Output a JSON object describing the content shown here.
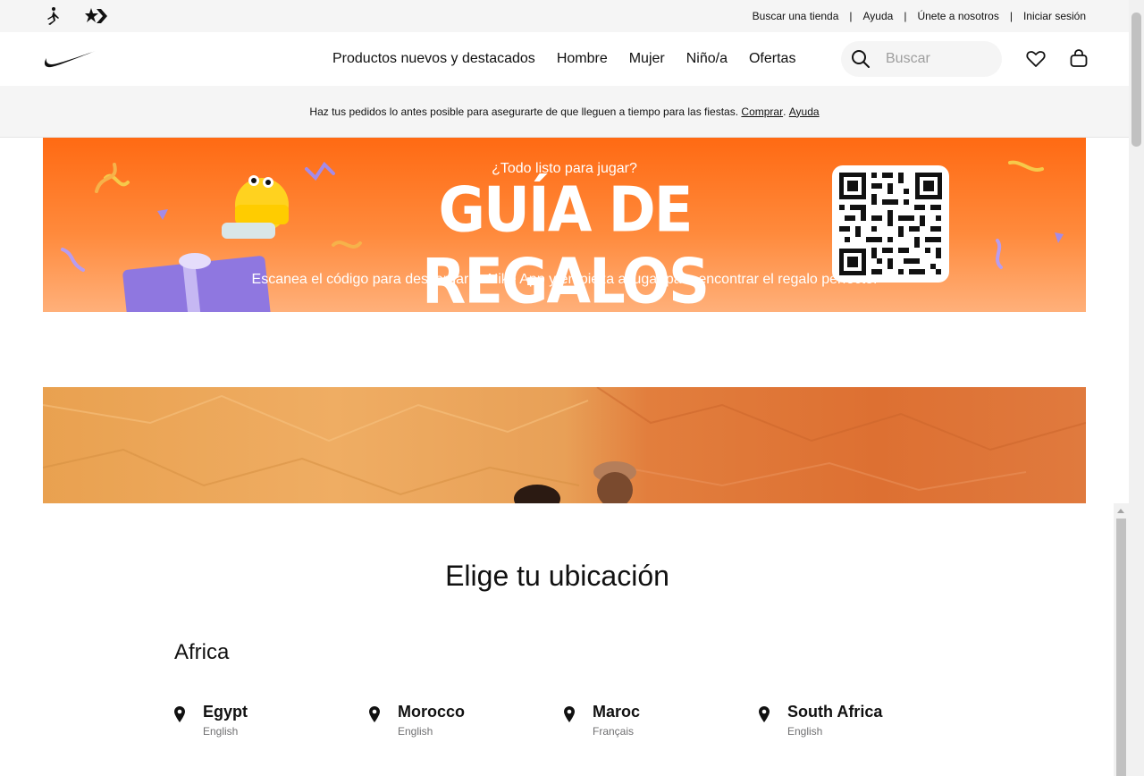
{
  "utility": {
    "links": [
      "Buscar una tienda",
      "Ayuda",
      "Únete a nosotros",
      "Iniciar sesión"
    ],
    "separator": "|"
  },
  "nav": {
    "menu": [
      "Productos nuevos y destacados",
      "Hombre",
      "Mujer",
      "Niño/a",
      "Ofertas"
    ],
    "search_placeholder": "Buscar"
  },
  "promo": {
    "text": "Haz tus pedidos lo antes posible para asegurarte de que lleguen a tiempo para las fiestas.",
    "link_shop": "Comprar",
    "link_help": "Ayuda"
  },
  "banner": {
    "kicker": "¿Todo listo para jugar?",
    "headline": "GUÍA DE REGALOS",
    "subtext": "Escanea el código para descargar la Nike App y empieza a jugar para encontrar el regalo perfecto."
  },
  "locations": {
    "title": "Elige tu ubicación",
    "region": "Africa",
    "countries": [
      {
        "name": "Egypt",
        "language": "English"
      },
      {
        "name": "Morocco",
        "language": "English"
      },
      {
        "name": "Maroc",
        "language": "Français"
      },
      {
        "name": "South Africa",
        "language": "English"
      }
    ]
  },
  "colors": {
    "banner_orange": "#ff6a13",
    "promo_bg": "#f5f5f5",
    "text": "#111111",
    "subtext": "#707072"
  },
  "icons": [
    "jordan-logo-icon",
    "converse-logo-icon",
    "nike-swoosh-icon",
    "search-icon",
    "heart-icon",
    "bag-icon",
    "location-pin-icon",
    "qr-code-icon"
  ]
}
